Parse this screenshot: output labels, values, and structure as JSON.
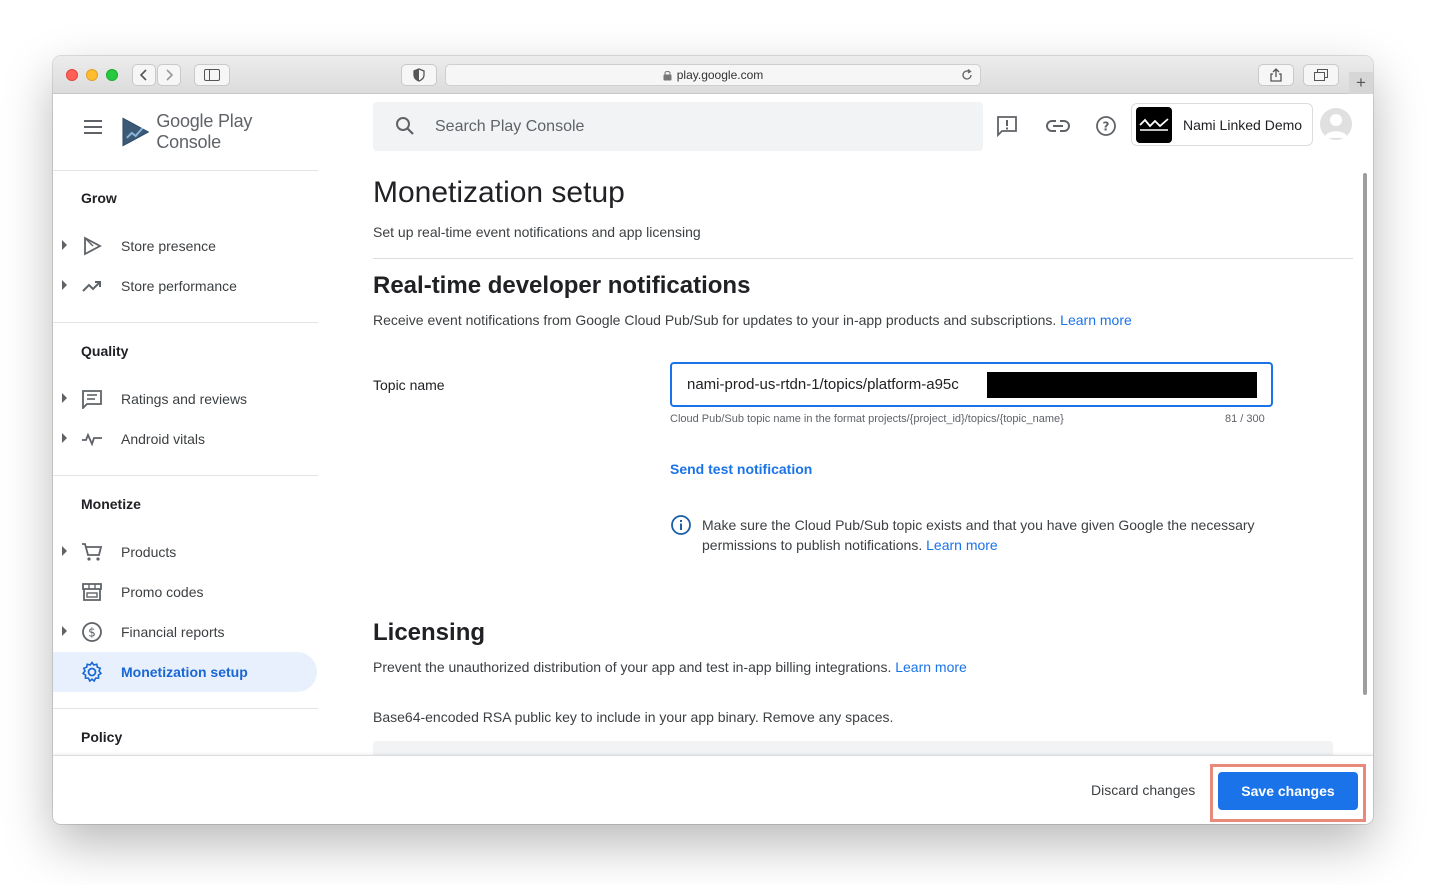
{
  "browser": {
    "url": "play.google.com"
  },
  "app": {
    "logo_text_google": "Google Play",
    "logo_text_console": "Console"
  },
  "search": {
    "placeholder": "Search Play Console"
  },
  "account": {
    "name": "Nami Linked Demo"
  },
  "sidebar": {
    "sections": [
      {
        "title": "Grow",
        "items": [
          {
            "label": "Store presence",
            "icon": "play-icon",
            "expandable": true
          },
          {
            "label": "Store performance",
            "icon": "trending-up-icon",
            "expandable": true
          }
        ]
      },
      {
        "title": "Quality",
        "items": [
          {
            "label": "Ratings and reviews",
            "icon": "reviews-icon",
            "expandable": true
          },
          {
            "label": "Android vitals",
            "icon": "vitals-icon",
            "expandable": true
          }
        ]
      },
      {
        "title": "Monetize",
        "items": [
          {
            "label": "Products",
            "icon": "cart-icon",
            "expandable": true
          },
          {
            "label": "Promo codes",
            "icon": "store-icon",
            "expandable": false
          },
          {
            "label": "Financial reports",
            "icon": "dollar-icon",
            "expandable": true
          },
          {
            "label": "Monetization setup",
            "icon": "gear-icon",
            "expandable": false,
            "active": true
          }
        ]
      },
      {
        "title": "Policy",
        "items": []
      }
    ]
  },
  "main": {
    "title": "Monetization setup",
    "subtitle": "Set up real-time event notifications and app licensing",
    "rtdn": {
      "heading": "Real-time developer notifications",
      "description": "Receive event notifications from Google Cloud Pub/Sub for updates to your in-app products and subscriptions.",
      "learn_more": "Learn more",
      "topic_label": "Topic name",
      "topic_value": "nami-prod-us-rtdn-1/topics/platform-a95c",
      "topic_helper": "Cloud Pub/Sub topic name in the format projects/{project_id}/topics/{topic_name}",
      "topic_counter": "81 / 300",
      "send_test": "Send test notification",
      "info_text": "Make sure the Cloud Pub/Sub topic exists and that you have given Google the necessary permissions to publish notifications.",
      "info_learn_more": "Learn more"
    },
    "licensing": {
      "heading": "Licensing",
      "description": "Prevent the unauthorized distribution of your app and test in-app billing integrations.",
      "learn_more": "Learn more",
      "rsa_label": "Base64-encoded RSA public key to include in your app binary. Remove any spaces."
    }
  },
  "footer": {
    "discard_label": "Discard changes",
    "save_label": "Save changes"
  },
  "colors": {
    "accent": "#1a73e8",
    "active_bg": "#e8f0fe",
    "highlight_outline": "#e8897a"
  }
}
